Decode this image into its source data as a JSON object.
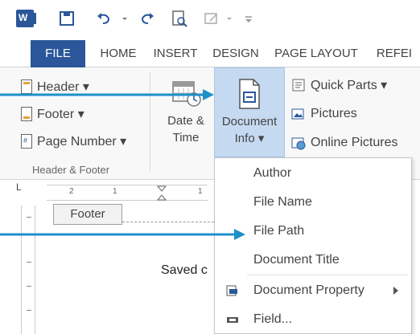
{
  "ribbon_tabs": [
    "FILE",
    "HOME",
    "INSERT",
    "DESIGN",
    "PAGE LAYOUT",
    "REFEI"
  ],
  "header_footer_group": {
    "items": [
      "Header ▾",
      "Footer ▾",
      "Page Number ▾"
    ],
    "label": "Header & Footer"
  },
  "date_time": {
    "line1": "Date &",
    "line2": "Time"
  },
  "document_info": {
    "line1": "Document",
    "line2": "Info ▾"
  },
  "insert_group": {
    "items": [
      "Quick Parts ▾",
      "Pictures",
      "Online Pictures"
    ]
  },
  "menu": {
    "items": [
      "Author",
      "File Name",
      "File Path",
      "Document Title",
      "Document Property",
      "Field..."
    ]
  },
  "document": {
    "footer_label": "Footer",
    "body_text": "Saved c"
  },
  "ruler": {
    "corner": "L",
    "marks": [
      "2",
      "1",
      "1"
    ]
  },
  "colors": {
    "accent": "#2b579a",
    "highlight": "#c5d9f1",
    "callout": "#1e90c8"
  },
  "icons": [
    "word-logo-icon",
    "save-icon",
    "undo-icon",
    "redo-icon",
    "print-preview-icon",
    "touch-mode-icon",
    "calendar-icon",
    "document-info-icon",
    "quick-parts-icon",
    "pictures-icon",
    "online-pictures-icon",
    "document-property-icon",
    "field-icon"
  ]
}
